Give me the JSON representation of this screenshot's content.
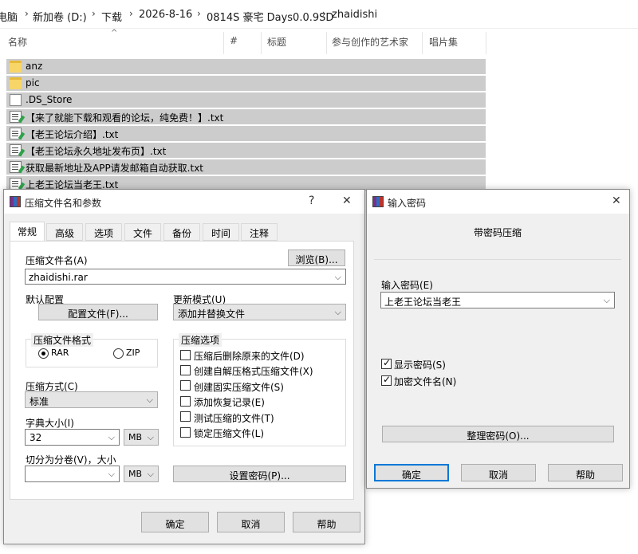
{
  "breadcrumb": [
    "电脑",
    "新加卷 (D:)",
    "下载",
    "2026-8-16",
    "0814S 豪宅 Days0.0.9SD",
    "zhaidishi"
  ],
  "explorer_columns": [
    "名称",
    "#",
    "标题",
    "参与创作的艺术家",
    "唱片集"
  ],
  "files": [
    {
      "name": "anz",
      "icon": "folder-icon"
    },
    {
      "name": "pic",
      "icon": "folder-icon"
    },
    {
      "name": ".DS_Store",
      "icon": "file-icon"
    },
    {
      "name": "【来了就能下载和观看的论坛，纯免费！】.txt",
      "icon": "text-file-icon"
    },
    {
      "name": "【老王论坛介绍】.txt",
      "icon": "text-file-icon"
    },
    {
      "name": "【老王论坛永久地址发布页】.txt",
      "icon": "text-file-icon"
    },
    {
      "name": "获取最新地址及APP请发邮箱自动获取.txt",
      "icon": "text-file-icon"
    },
    {
      "name": "上老王论坛当老王.txt",
      "icon": "text-file-icon"
    }
  ],
  "archive_dialog": {
    "title": "压缩文件名和参数",
    "help_glyph": "?",
    "close_glyph": "✕",
    "tabs": [
      "常规",
      "高级",
      "选项",
      "文件",
      "备份",
      "时间",
      "注释"
    ],
    "active_tab": "常规",
    "archive_name_label": "压缩文件名(A)",
    "archive_name_value": "zhaidishi.rar",
    "browse_label": "浏览(B)...",
    "default_profile_label": "默认配置",
    "profile_button": "配置文件(F)...",
    "update_mode_label": "更新模式(U)",
    "update_mode_value": "添加并替换文件",
    "format_group": "压缩文件格式",
    "format_rar": "RAR",
    "format_zip": "ZIP",
    "selected_format": "RAR",
    "options_group": "压缩选项",
    "options": [
      {
        "label": "压缩后删除原来的文件(D)",
        "checked": false
      },
      {
        "label": "创建自解压格式压缩文件(X)",
        "checked": false
      },
      {
        "label": "创建固实压缩文件(S)",
        "checked": false
      },
      {
        "label": "添加恢复记录(E)",
        "checked": false
      },
      {
        "label": "测试压缩的文件(T)",
        "checked": false
      },
      {
        "label": "锁定压缩文件(L)",
        "checked": false
      }
    ],
    "method_label": "压缩方式(C)",
    "method_value": "标准",
    "dict_label": "字典大小(I)",
    "dict_value": "32",
    "dict_unit": "MB",
    "split_label": "切分为分卷(V)，大小",
    "split_value": "",
    "split_unit": "MB",
    "set_password_button": "设置密码(P)...",
    "ok": "确定",
    "cancel": "取消",
    "help": "帮助"
  },
  "password_dialog": {
    "title": "输入密码",
    "close_glyph": "✕",
    "heading": "带密码压缩",
    "password_label": "输入密码(E)",
    "password_value": "上老王论坛当老王",
    "show_password_label": "显示密码(S)",
    "show_password_checked": true,
    "encrypt_names_label": "加密文件名(N)",
    "encrypt_names_checked": true,
    "organize_button": "整理密码(O)...",
    "ok": "确定",
    "cancel": "取消",
    "help": "帮助"
  }
}
